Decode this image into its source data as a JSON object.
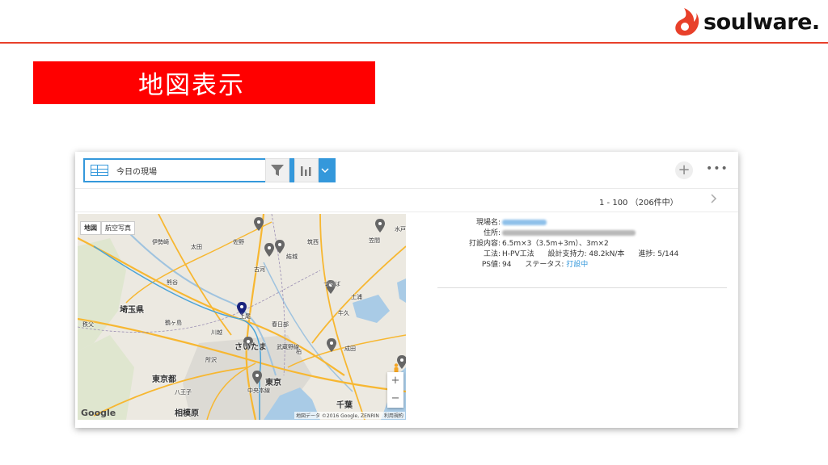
{
  "header": {
    "brand": "soulware.",
    "brand_color": "#e8402a"
  },
  "title": {
    "text": "地図表示",
    "band_color": "#ff0000"
  },
  "toolbar": {
    "view_name": "今日の現場",
    "view_icon": "table-icon",
    "graph_icon": "line-graph-icon",
    "filter_icon": "filter-icon",
    "chart_icon": "bar-chart-icon",
    "add_icon": "plus-icon",
    "more_icon": "ellipsis-icon",
    "accent_color": "#3498db"
  },
  "pagination": {
    "text": "1 - 100 （206件中）"
  },
  "map": {
    "tabs": [
      "地図",
      "航空写真"
    ],
    "zoom_in": "+",
    "zoom_out": "−",
    "google": "Google",
    "attribution": "地図データ ©2016 Google, ZENRIN　利用規約",
    "labels": [
      {
        "text": "埼玉県",
        "big": true
      },
      {
        "text": "東京都",
        "big": true
      },
      {
        "text": "相模原",
        "big": true
      },
      {
        "text": "千葉",
        "big": true
      },
      {
        "text": "さいたま",
        "big": true
      },
      {
        "text": "東京",
        "big": true
      },
      {
        "text": "川越",
        "big": false
      },
      {
        "text": "所沢",
        "big": false
      },
      {
        "text": "八王子",
        "big": false
      },
      {
        "text": "上尾",
        "big": false
      },
      {
        "text": "伊勢崎",
        "big": false
      },
      {
        "text": "太田",
        "big": false
      },
      {
        "text": "佐野",
        "big": false
      },
      {
        "text": "古河",
        "big": false
      },
      {
        "text": "結城",
        "big": false
      },
      {
        "text": "筑西",
        "big": false
      },
      {
        "text": "つくば",
        "big": false
      },
      {
        "text": "土浦",
        "big": false
      },
      {
        "text": "牛久",
        "big": false
      },
      {
        "text": "熊谷",
        "big": false
      },
      {
        "text": "春日部",
        "big": false
      },
      {
        "text": "成田",
        "big": false
      },
      {
        "text": "柏",
        "big": false
      },
      {
        "text": "笠間",
        "big": false
      },
      {
        "text": "水戸",
        "big": false
      },
      {
        "text": "秩父",
        "big": false
      },
      {
        "text": "武蔵野線",
        "big": false
      },
      {
        "text": "中央本線",
        "big": false
      },
      {
        "text": "鶴ヶ島",
        "big": false
      }
    ]
  },
  "details": {
    "site_label": "現場名:",
    "address_label": "住所:",
    "pile_label": "打設内容:",
    "pile_value": "6.5m×3（3.5m+3m）、3m×2",
    "method_label": "工法:",
    "method_value": "H-PV工法",
    "design_label": "設計支持力:",
    "design_value": "48.2kN/本",
    "progress_label": "進捗:",
    "progress_value": "5/144",
    "ps_label": "PS値:",
    "ps_value": "94",
    "status_label": "ステータス:",
    "status_value": "打設中"
  }
}
